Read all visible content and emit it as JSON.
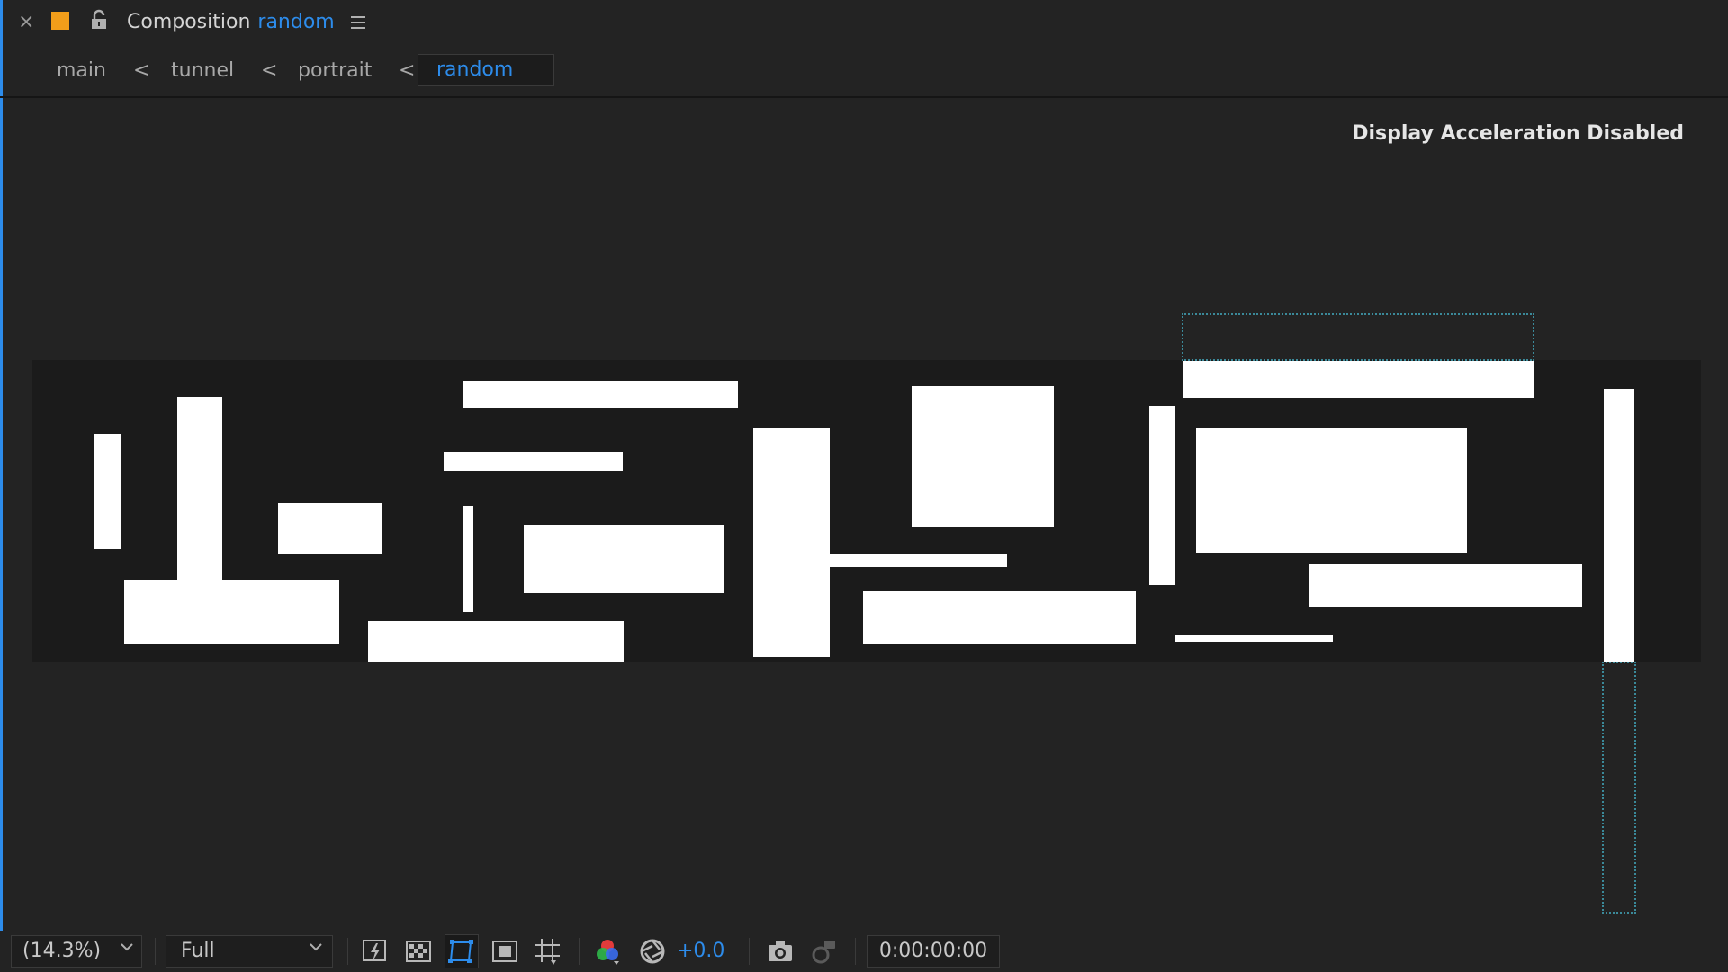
{
  "panel": {
    "close_glyph": "×",
    "label_color": "#f29e1a",
    "title_prefix": "Composition",
    "comp_name": "random",
    "accent_color": "#2d8ceb"
  },
  "breadcrumbs": {
    "items": [
      "main",
      "tunnel",
      "portrait"
    ],
    "separator": "<",
    "active": "random"
  },
  "viewer": {
    "notice": "Display Acceleration Disabled"
  },
  "toolbar": {
    "zoom": "(14.3%)",
    "resolution": "Full",
    "exposure": "+0.0",
    "timecode": "0:00:00:00",
    "icons": [
      "always-preview-icon",
      "transparency-grid-icon",
      "mask-path-visibility-icon",
      "region-of-interest-icon",
      "grid-guides-icon",
      "channel-icon",
      "reset-exposure-icon",
      "snapshot-icon",
      "show-snapshot-icon"
    ]
  }
}
